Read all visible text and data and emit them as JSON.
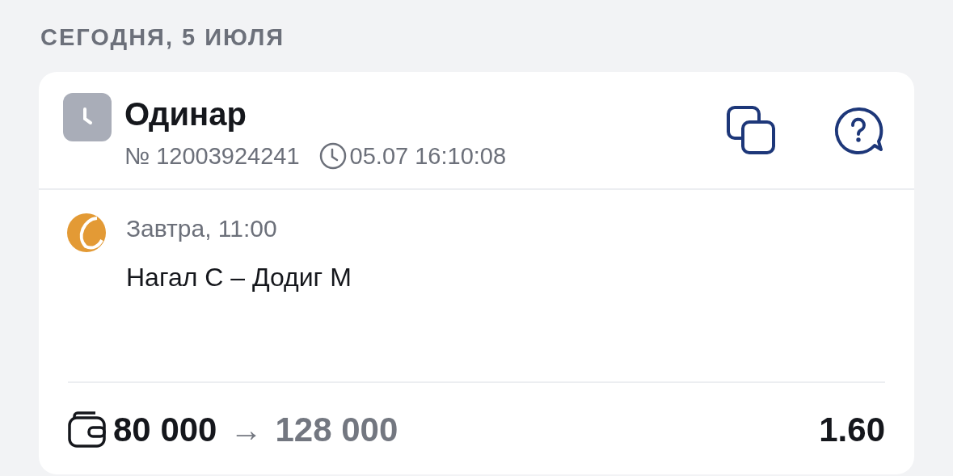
{
  "date_heading": "СЕГОДНЯ, 5 ИЮЛЯ",
  "bet": {
    "type": "Одинар",
    "number": "№ 12003924241",
    "time": "05.07 16:10:08",
    "events": [
      {
        "kind": "tennis",
        "when": "Завтра, 11:00",
        "teams": "Нагал С – Додиг М"
      }
    ],
    "stake": "80 000",
    "arrow": "→",
    "payout": "128 000",
    "odds": "1.60"
  }
}
